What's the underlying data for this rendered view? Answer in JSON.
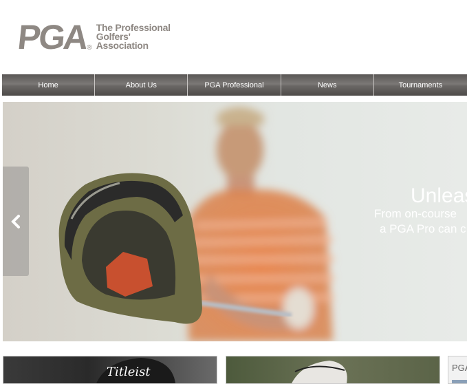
{
  "logo": {
    "mark": "PGA",
    "registered": "®",
    "line1": "The Professional",
    "line2": "Golfers'",
    "line3": "Association"
  },
  "nav": [
    "Home",
    "About Us",
    "PGA Professional",
    "News",
    "Tournaments"
  ],
  "hero": {
    "title": "Unleas",
    "sub1": "From on-course",
    "sub2": "a PGA Pro can c",
    "prev_icon": "chevron-left-icon"
  },
  "tiles": {
    "third_label": "PGA"
  }
}
